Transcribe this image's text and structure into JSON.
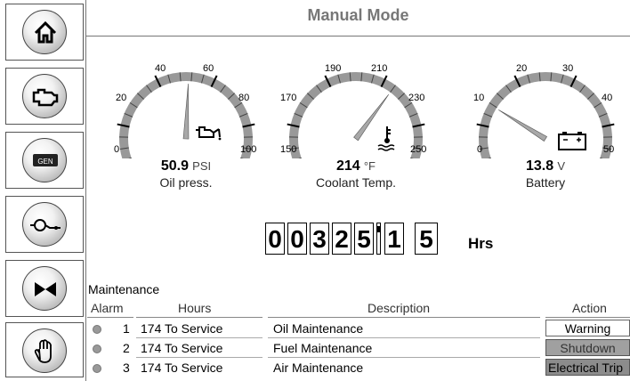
{
  "header": {
    "title": "Manual Mode"
  },
  "sidebar": {
    "items": [
      {
        "name": "home"
      },
      {
        "name": "engine"
      },
      {
        "name": "generator",
        "label": "GEN"
      },
      {
        "name": "transfer"
      },
      {
        "name": "breaker"
      },
      {
        "name": "stop"
      }
    ]
  },
  "gauges": [
    {
      "label": "Oil press.",
      "value": "50.9",
      "unit": "PSI",
      "ticks": [
        "0",
        "20",
        "40",
        "60",
        "80",
        "100"
      ],
      "icon": "oil-can-icon"
    },
    {
      "label": "Coolant Temp.",
      "value": "214",
      "unit": "°F",
      "ticks": [
        "150",
        "170",
        "190",
        "210",
        "230",
        "250"
      ],
      "icon": "coolant-temp-icon"
    },
    {
      "label": "Battery",
      "value": "13.8",
      "unit": "V",
      "ticks": [
        "0",
        "10",
        "20",
        "30",
        "40",
        "50"
      ],
      "icon": "battery-icon"
    }
  ],
  "hour_meter": {
    "digits": [
      "0",
      "0",
      "3",
      "2",
      "5",
      "1",
      "5"
    ],
    "unit": "Hrs"
  },
  "maintenance": {
    "title": "Maintenance",
    "headers": {
      "alarm": "Alarm",
      "hours": "Hours",
      "description": "Description",
      "action": "Action"
    },
    "rows": [
      {
        "alarm": "1",
        "hours": "174 To Service",
        "description": "Oil Maintenance",
        "action": "Warning"
      },
      {
        "alarm": "2",
        "hours": "174 To Service",
        "description": "Fuel Maintenance",
        "action": "Shutdown"
      },
      {
        "alarm": "3",
        "hours": "174 To Service",
        "description": "Air Maintenance",
        "action": "Electrical Trip"
      }
    ]
  },
  "colors": {
    "header_text": "#777777",
    "shutdown_bg": "#a0a0a0",
    "trip_bg": "#8c8c8c"
  }
}
